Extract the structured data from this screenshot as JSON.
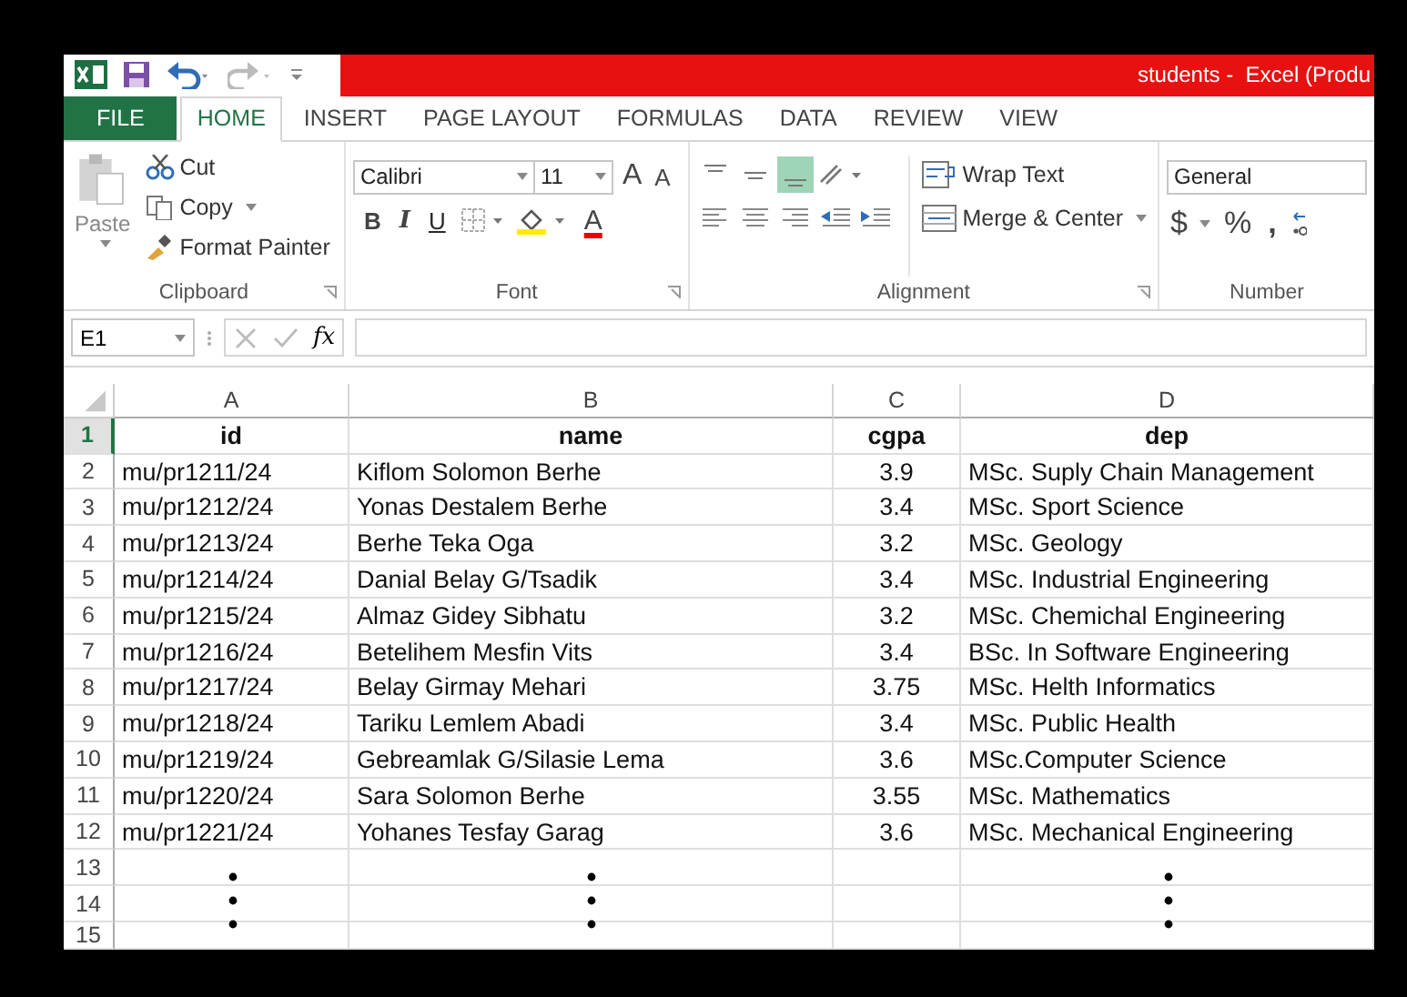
{
  "window": {
    "title": "students -  Excel (Produ"
  },
  "tabs": [
    {
      "label": "FILE",
      "kind": "file",
      "selected": false
    },
    {
      "label": "HOME",
      "kind": "tab",
      "selected": true
    },
    {
      "label": "INSERT",
      "kind": "tab",
      "selected": false
    },
    {
      "label": "PAGE LAYOUT",
      "kind": "tab",
      "selected": false
    },
    {
      "label": "FORMULAS",
      "kind": "tab",
      "selected": false
    },
    {
      "label": "DATA",
      "kind": "tab",
      "selected": false
    },
    {
      "label": "REVIEW",
      "kind": "tab",
      "selected": false
    },
    {
      "label": "VIEW",
      "kind": "tab",
      "selected": false
    }
  ],
  "clipboard": {
    "paste": "Paste",
    "cut": "Cut",
    "copy": "Copy",
    "format_painter": "Format Painter",
    "label": "Clipboard"
  },
  "font": {
    "name": "Calibri",
    "size": "11",
    "grow": "A",
    "shrink": "A",
    "bold": "B",
    "italic": "I",
    "underline": "U",
    "font_color": "A",
    "label": "Font"
  },
  "alignment": {
    "align_buttons": [
      {
        "selected": false
      },
      {
        "selected": false
      },
      {
        "selected": true
      }
    ],
    "wrap": "Wrap Text",
    "merge": "Merge & Center",
    "label": "Alignment"
  },
  "number": {
    "format": "General",
    "currency": "$",
    "percent": "%",
    "comma": ",",
    "label": "Number"
  },
  "formula_bar": {
    "name_box": "E1",
    "fx": "fx"
  },
  "columns": [
    {
      "letter": "A",
      "kind": "text"
    },
    {
      "letter": "B",
      "kind": "text"
    },
    {
      "letter": "C",
      "kind": "number"
    },
    {
      "letter": "D",
      "kind": "text"
    }
  ],
  "rows": [
    {
      "number": "1",
      "active": true,
      "cells": [
        "id",
        "name",
        "cgpa",
        "dep"
      ]
    },
    {
      "number": "2",
      "active": false,
      "cells": [
        "mu/pr1211/24",
        "Kiflom Solomon Berhe",
        "3.9",
        "MSc. Suply Chain Management"
      ]
    },
    {
      "number": "3",
      "active": false,
      "cells": [
        "mu/pr1212/24",
        "Yonas Destalem Berhe",
        "3.4",
        "MSc. Sport Science"
      ]
    },
    {
      "number": "4",
      "active": false,
      "cells": [
        "mu/pr1213/24",
        "Berhe Teka Oga",
        "3.2",
        "MSc. Geology"
      ]
    },
    {
      "number": "5",
      "active": false,
      "cells": [
        "mu/pr1214/24",
        "Danial Belay G/Tsadik",
        "3.4",
        "MSc. Industrial Engineering"
      ]
    },
    {
      "number": "6",
      "active": false,
      "cells": [
        "mu/pr1215/24",
        "Almaz Gidey Sibhatu",
        "3.2",
        "MSc. Chemichal Engineering"
      ]
    },
    {
      "number": "7",
      "active": false,
      "cells": [
        "mu/pr1216/24",
        "Betelihem Mesfin Vits",
        "3.4",
        "BSc. In Software Engineering"
      ]
    },
    {
      "number": "8",
      "active": false,
      "cells": [
        "mu/pr1217/24",
        "Belay Girmay Mehari",
        "3.75",
        "MSc. Helth Informatics"
      ]
    },
    {
      "number": "9",
      "active": false,
      "cells": [
        "mu/pr1218/24",
        "Tariku Lemlem Abadi",
        "3.4",
        "MSc. Public Health"
      ]
    },
    {
      "number": "10",
      "active": false,
      "cells": [
        "mu/pr1219/24",
        "Gebreamlak G/Silasie Lema",
        "3.6",
        "MSc.Computer Science"
      ]
    },
    {
      "number": "11",
      "active": false,
      "cells": [
        "mu/pr1220/24",
        "Sara Solomon Berhe",
        "3.55",
        "MSc. Mathematics"
      ]
    },
    {
      "number": "12",
      "active": false,
      "cells": [
        "mu/pr1221/24",
        "Yohanes Tesfay Garag",
        "3.6",
        "MSc. Mechanical Engineering"
      ]
    },
    {
      "number": "13",
      "active": false,
      "cells": []
    },
    {
      "number": "14",
      "active": false,
      "cells": []
    },
    {
      "number": "15",
      "active": false,
      "cells": []
    }
  ]
}
